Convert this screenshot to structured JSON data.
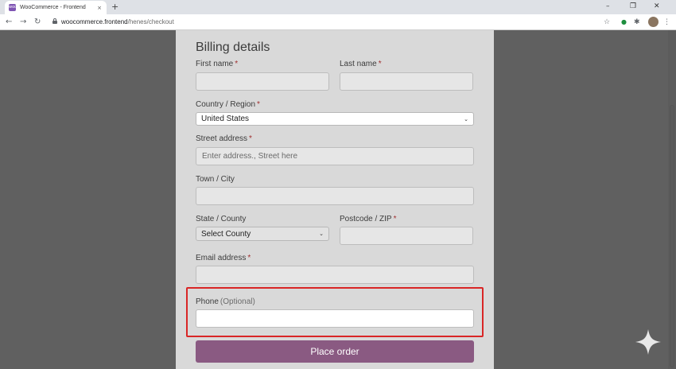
{
  "browser": {
    "tab_title": "WooCommerce - Frontend",
    "tab_favicon_text": "woo",
    "tab_close_icon": "×",
    "new_tab_icon": "+",
    "url_host": "woocommerce.frontend",
    "url_path": "/henes/checkout",
    "window_controls": {
      "minimize": "–",
      "maximize": "❐",
      "close": "✕"
    },
    "nav": {
      "back": "←",
      "forward": "→",
      "reload": "↻"
    },
    "toolbar_icons": {
      "star": "☆",
      "extension_green": "●",
      "puzzle": "✱",
      "menu": "⋮"
    },
    "accent_color": "#7f54b3"
  },
  "form": {
    "heading": "Billing details",
    "required_mark": "*",
    "first_name": {
      "label": "First name",
      "value": ""
    },
    "last_name": {
      "label": "Last name",
      "value": ""
    },
    "country": {
      "label": "Country / Region",
      "selected": "United States",
      "chevron": "⌄"
    },
    "street": {
      "label": "Street address",
      "placeholder": "Enter address., Street here"
    },
    "town": {
      "label": "Town / City",
      "value": ""
    },
    "state": {
      "label": "State / County",
      "selected": "Select County",
      "chevron": "⌄"
    },
    "postcode": {
      "label": "Postcode / ZIP",
      "value": ""
    },
    "email": {
      "label": "Email address",
      "value": ""
    },
    "phone": {
      "label": "Phone",
      "optional": "(Optional)",
      "value": ""
    },
    "place_order": "Place order",
    "button_color": "#8a5a82",
    "highlight_color": "#d92626"
  }
}
